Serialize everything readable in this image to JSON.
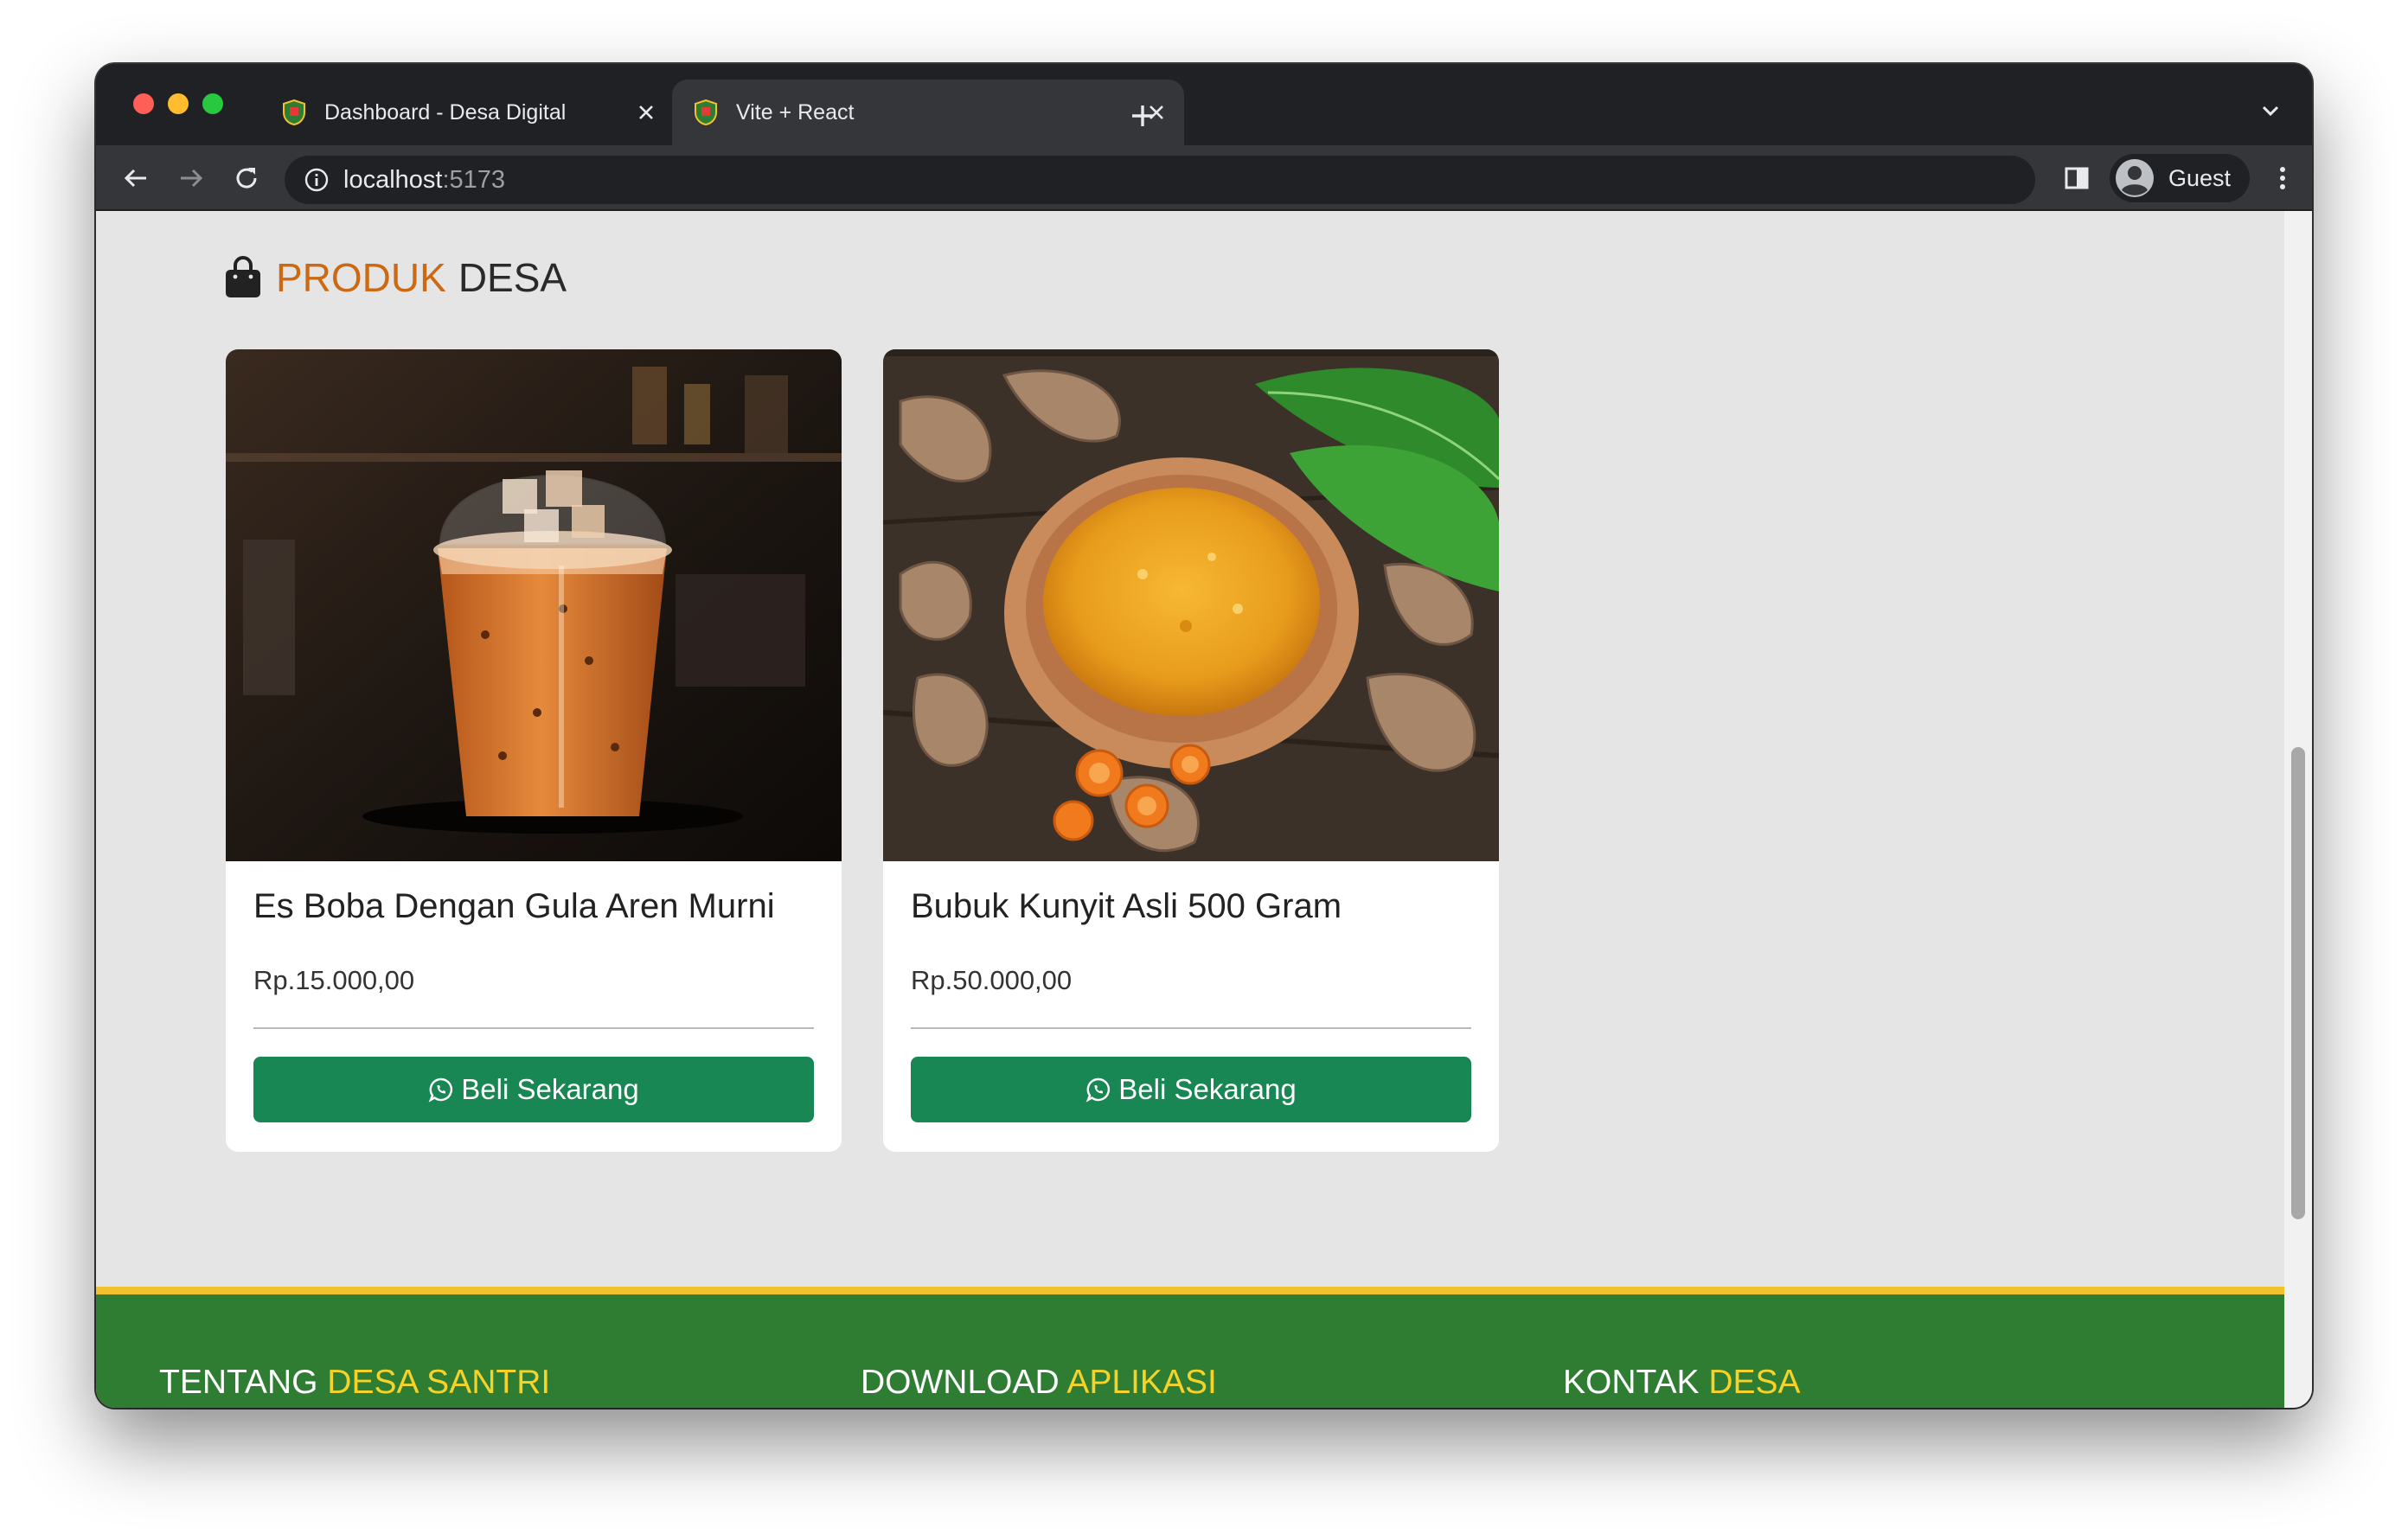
{
  "browser": {
    "tabs": [
      {
        "title": "Dashboard - Desa Digital",
        "active": false
      },
      {
        "title": "Vite + React",
        "active": true
      }
    ],
    "url_host": "localhost",
    "url_port": ":5173",
    "profile_name": "Guest"
  },
  "page": {
    "section": {
      "title_accent": "PRODUK",
      "title_rest": "DESA"
    },
    "products": [
      {
        "name": "Es Boba Dengan Gula Aren Murni",
        "price": "Rp.15.000,00",
        "button_label": "Beli Sekarang"
      },
      {
        "name": "Bubuk Kunyit Asli 500 Gram",
        "price": "Rp.50.000,00",
        "button_label": "Beli Sekarang"
      }
    ],
    "footer": [
      {
        "title": "TENTANG",
        "highlight": "DESA SANTRI"
      },
      {
        "title": "DOWNLOAD",
        "highlight": "APLIKASI"
      },
      {
        "title": "KONTAK",
        "highlight": "DESA"
      }
    ]
  },
  "colors": {
    "accent_orange": "#cc6a14",
    "button_green": "#198754",
    "footer_green": "#2e7d32",
    "footer_highlight": "#f7d32a",
    "footer_border": "#f2c12e"
  },
  "icons": [
    "shield-favicon-icon",
    "close-icon",
    "plus-icon",
    "chevron-down-icon",
    "back-arrow-icon",
    "forward-arrow-icon",
    "reload-icon",
    "info-icon",
    "side-panel-icon",
    "profile-avatar-icon",
    "kebab-menu-icon",
    "shopping-bag-icon",
    "whatsapp-icon"
  ]
}
